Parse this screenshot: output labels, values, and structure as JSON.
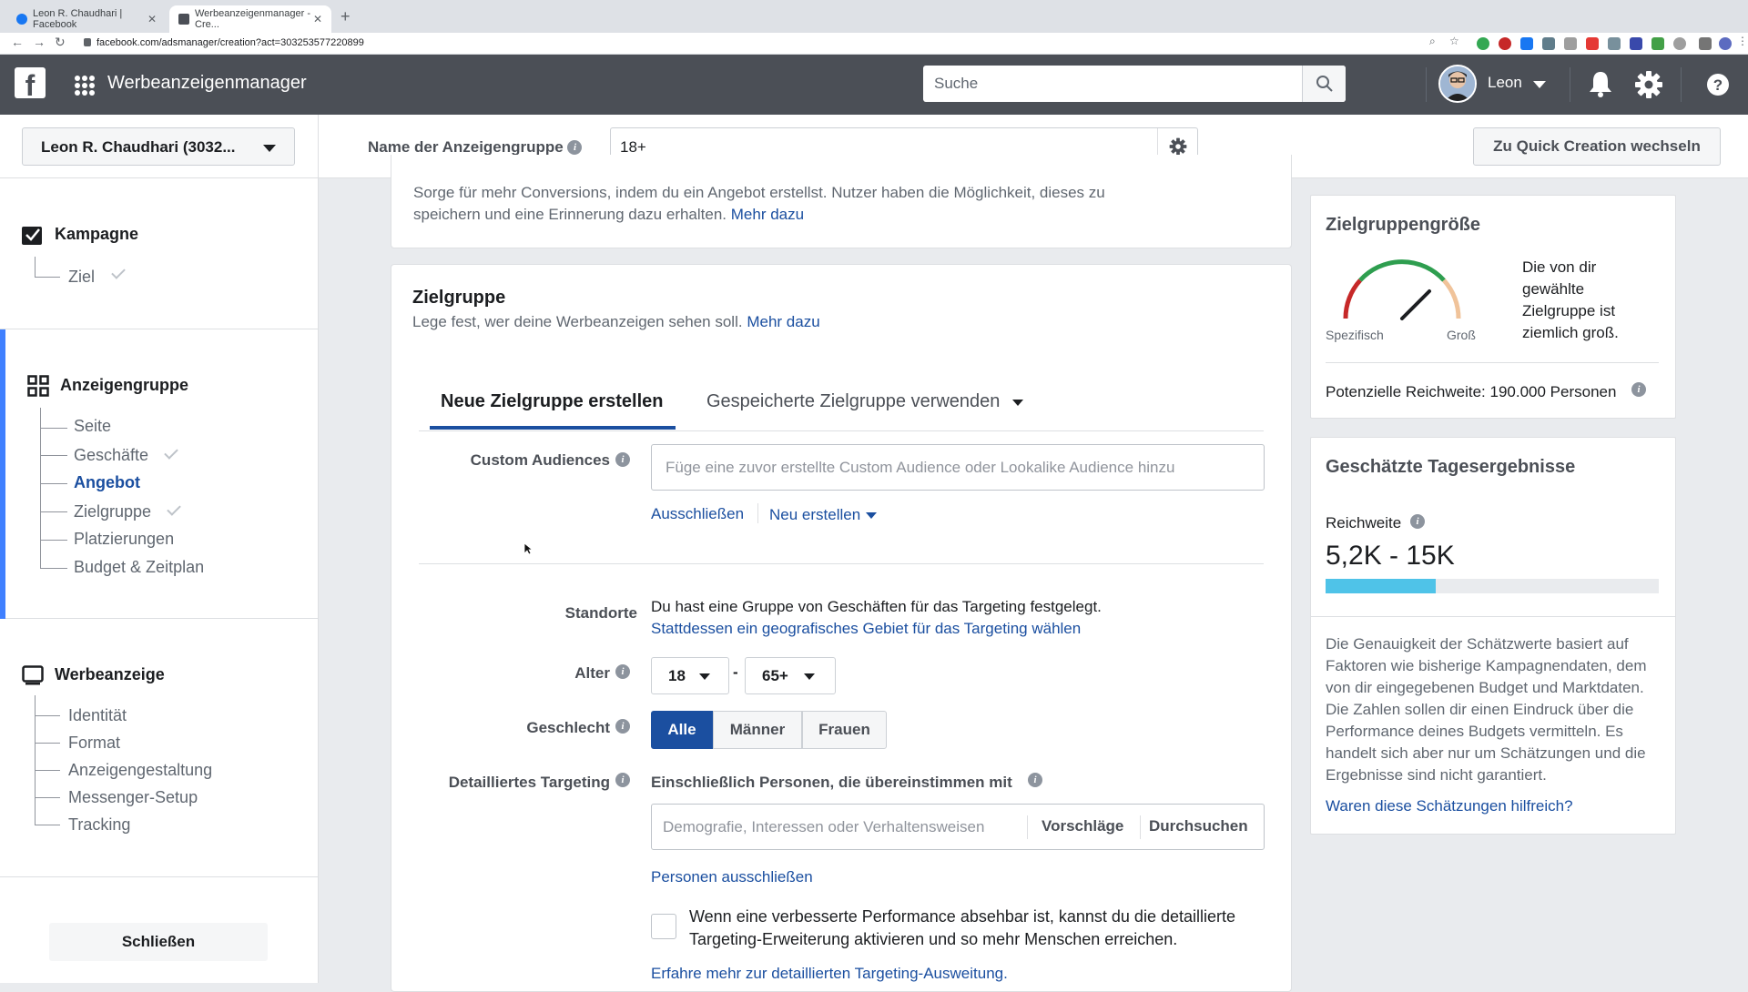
{
  "browser": {
    "tabs": [
      {
        "title": "Leon R. Chaudhari | Facebook"
      },
      {
        "title": "Werbeanzeigenmanager - Cre..."
      }
    ],
    "url": "facebook.com/adsmanager/creation?act=303253577220899"
  },
  "header": {
    "app_title": "Werbeanzeigenmanager",
    "search_placeholder": "Suche",
    "user_name": "Leon"
  },
  "subheader": {
    "account": "Leon R. Chaudhari (3032...",
    "adset_name_label": "Name der Anzeigengruppe",
    "adset_name_value": "18+",
    "quick_creation": "Zu Quick Creation wechseln"
  },
  "sidebar": {
    "campaign": {
      "title": "Kampagne",
      "items": [
        "Ziel"
      ]
    },
    "adset": {
      "title": "Anzeigengruppe",
      "items": [
        "Seite",
        "Geschäfte",
        "Angebot",
        "Zielgruppe",
        "Platzierungen",
        "Budget & Zeitplan"
      ]
    },
    "ad": {
      "title": "Werbeanzeige",
      "items": [
        "Identität",
        "Format",
        "Anzeigengestaltung",
        "Messenger-Setup",
        "Tracking"
      ]
    },
    "close": "Schließen"
  },
  "offer_card": {
    "text": "Sorge für mehr Conversions, indem du ein Angebot erstellst. Nutzer haben die Möglichkeit, dieses zu speichern und eine Erinnerung dazu erhalten.",
    "link": "Mehr dazu"
  },
  "audience": {
    "title": "Zielgruppe",
    "subtitle": "Lege fest, wer deine Werbeanzeigen sehen soll.",
    "subtitle_link": "Mehr dazu",
    "tab_new": "Neue Zielgruppe erstellen",
    "tab_saved": "Gespeicherte Zielgruppe verwenden",
    "custom_label": "Custom Audiences",
    "custom_placeholder": "Füge eine zuvor erstellte Custom Audience oder Lookalike Audience hinzu",
    "exclude": "Ausschließen",
    "create_new": "Neu erstellen",
    "locations_label": "Standorte",
    "locations_text": "Du hast eine Gruppe von Geschäften für das Targeting festgelegt.",
    "locations_link": "Stattdessen ein geografisches Gebiet für das Targeting wählen",
    "age_label": "Alter",
    "age_min": "18",
    "age_sep": "-",
    "age_max": "65+",
    "gender_label": "Geschlecht",
    "gender_all": "Alle",
    "gender_men": "Männer",
    "gender_women": "Frauen",
    "detailed_label": "Detailliertes Targeting",
    "detailed_include": "Einschließlich Personen, die übereinstimmen mit",
    "detailed_placeholder": "Demografie, Interessen oder Verhaltensweisen",
    "suggestions": "Vorschläge",
    "browse": "Durchsuchen",
    "exclude_people": "Personen ausschließen",
    "expansion_text": "Wenn eine verbesserte Performance absehbar ist, kannst du die detaillierte Targeting-Erweiterung aktivieren und so mehr Menschen erreichen.",
    "expansion_link": "Erfahre mehr zur detaillierten Targeting-Ausweitung."
  },
  "audience_size": {
    "title": "Zielgruppengröße",
    "specific": "Spezifisch",
    "broad": "Groß",
    "description": "Die von dir gewählte Zielgruppe ist ziemlich groß.",
    "potential_reach": "Potenzielle Reichweite: 190.000 Personen"
  },
  "daily_results": {
    "title": "Geschätzte Tagesergebnisse",
    "reach_label": "Reichweite",
    "reach_value": "5,2K - 15K",
    "reach_fill_fraction": 0.33,
    "disclaimer": "Die Genauigkeit der Schätzwerte basiert auf Faktoren wie bisherige Kampagnendaten, dem von dir eingegebenen Budget und Marktdaten. Die Zahlen sollen dir einen Eindruck über die Performance deines Budgets vermitteln. Es handelt sich aber nur um Schätzungen und die Ergebnisse sind nicht garantiert.",
    "feedback": "Waren diese Schätzungen hilfreich?"
  },
  "colors": {
    "header": "#4b4f56",
    "accent": "#1b4fa0",
    "active_bar": "#4080ff",
    "reach_bar": "#4fc3e8"
  }
}
